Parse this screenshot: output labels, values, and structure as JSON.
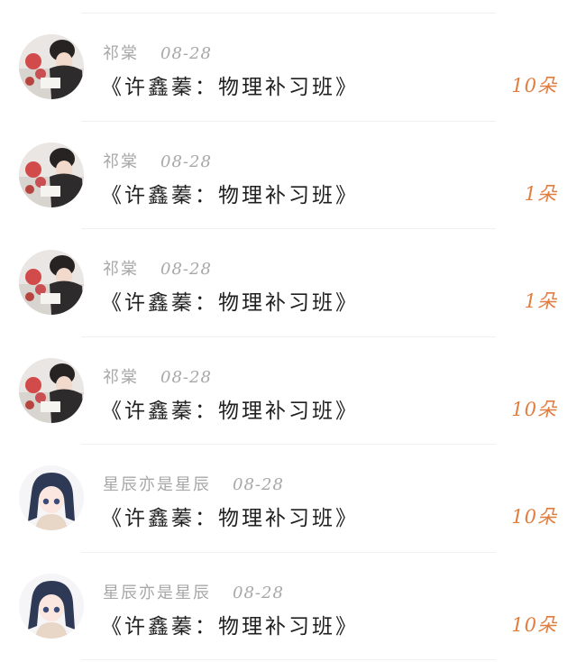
{
  "gifts": [
    {
      "user": "祁棠",
      "date": "08-28",
      "title": "《许鑫蓁：物理补习班》",
      "amount": "10朵",
      "avatar": "photo-avatar"
    },
    {
      "user": "祁棠",
      "date": "08-28",
      "title": "《许鑫蓁：物理补习班》",
      "amount": "1朵",
      "avatar": "photo-avatar"
    },
    {
      "user": "祁棠",
      "date": "08-28",
      "title": "《许鑫蓁：物理补习班》",
      "amount": "1朵",
      "avatar": "photo-avatar"
    },
    {
      "user": "祁棠",
      "date": "08-28",
      "title": "《许鑫蓁：物理补习班》",
      "amount": "10朵",
      "avatar": "photo-avatar"
    },
    {
      "user": "星辰亦是星辰",
      "date": "08-28",
      "title": "《许鑫蓁：物理补习班》",
      "amount": "10朵",
      "avatar": "anime-avatar"
    },
    {
      "user": "星辰亦是星辰",
      "date": "08-28",
      "title": "《许鑫蓁：物理补习班》",
      "amount": "10朵",
      "avatar": "anime-avatar"
    }
  ],
  "colors": {
    "amount": "#e07d3f",
    "meta": "#a8a8a8",
    "title": "#1f1f1f",
    "divider": "#f0f0f0"
  }
}
